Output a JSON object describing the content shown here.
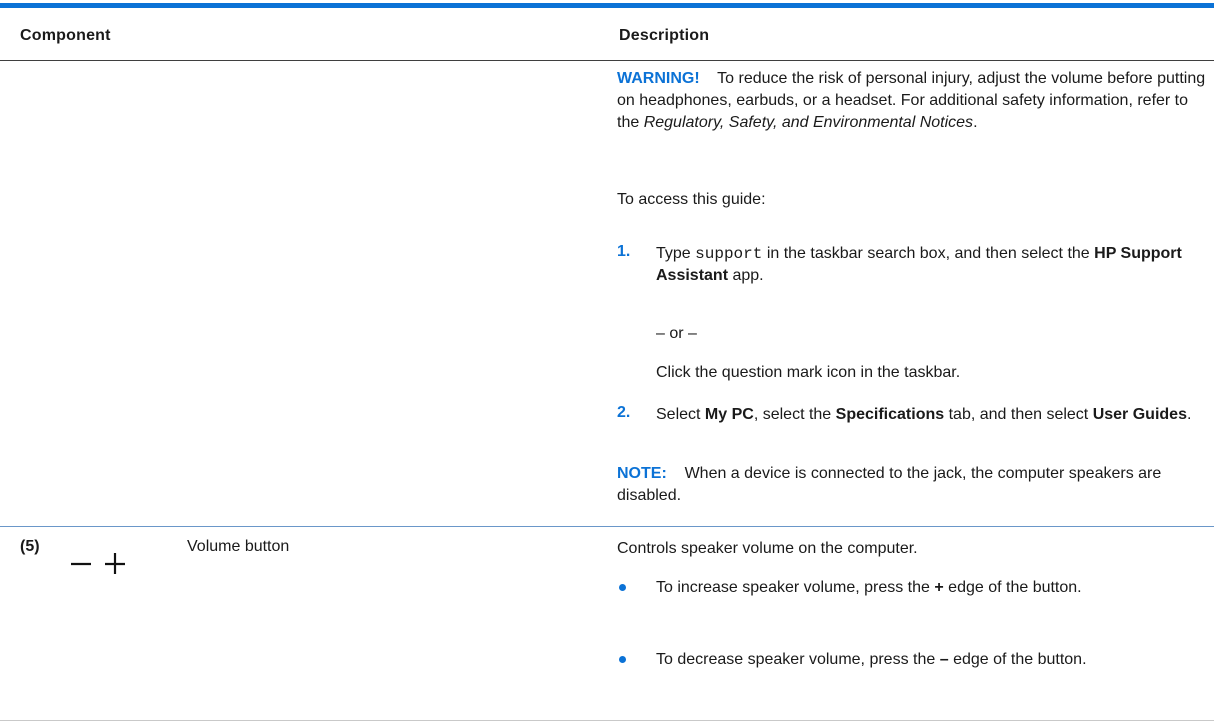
{
  "table": {
    "header": {
      "component": "Component",
      "description": "Description"
    },
    "row_audio": {
      "warning": {
        "label": "WARNING!",
        "text": "To reduce the risk of personal injury, adjust the volume before putting on headphones, earbuds, or a headset. For additional safety information, refer to the",
        "doc_title": "Regulatory, Safety, and Environmental Notices",
        "end": "."
      },
      "access_intro": "To access this guide:",
      "steps": [
        {
          "num": "1.",
          "pre": "Type",
          "code": "support",
          "mid": "in the taskbar search box, and then select the",
          "app": "HP Support Assistant",
          "post": "app."
        },
        {
          "num": "2.",
          "pre": "Select",
          "b1": "My PC",
          "mid1": ", select the",
          "b2": "Specifications",
          "mid2": "tab, and then select",
          "b3": "User Guides",
          "post": "."
        }
      ],
      "or_text": "– or –",
      "alt_step": "Click the question mark icon in the taskbar.",
      "note": {
        "label": "NOTE:",
        "text": "When a device is connected to the jack, the computer speakers are disabled."
      }
    },
    "row_volume": {
      "item_num": "(5)",
      "icon": "volume-minus-plus-icon",
      "component": "Volume button",
      "description": "Controls speaker volume on the computer.",
      "bullets": [
        {
          "pre": "To increase speaker volume, press the",
          "key": "+",
          "post": "edge of the button."
        },
        {
          "pre": "To decrease speaker volume, press the",
          "key": "–",
          "post": "edge of the button."
        }
      ]
    }
  },
  "colors": {
    "accent": "#0b72d6",
    "text": "#1a1a1a",
    "rule": "#6a97c9"
  }
}
